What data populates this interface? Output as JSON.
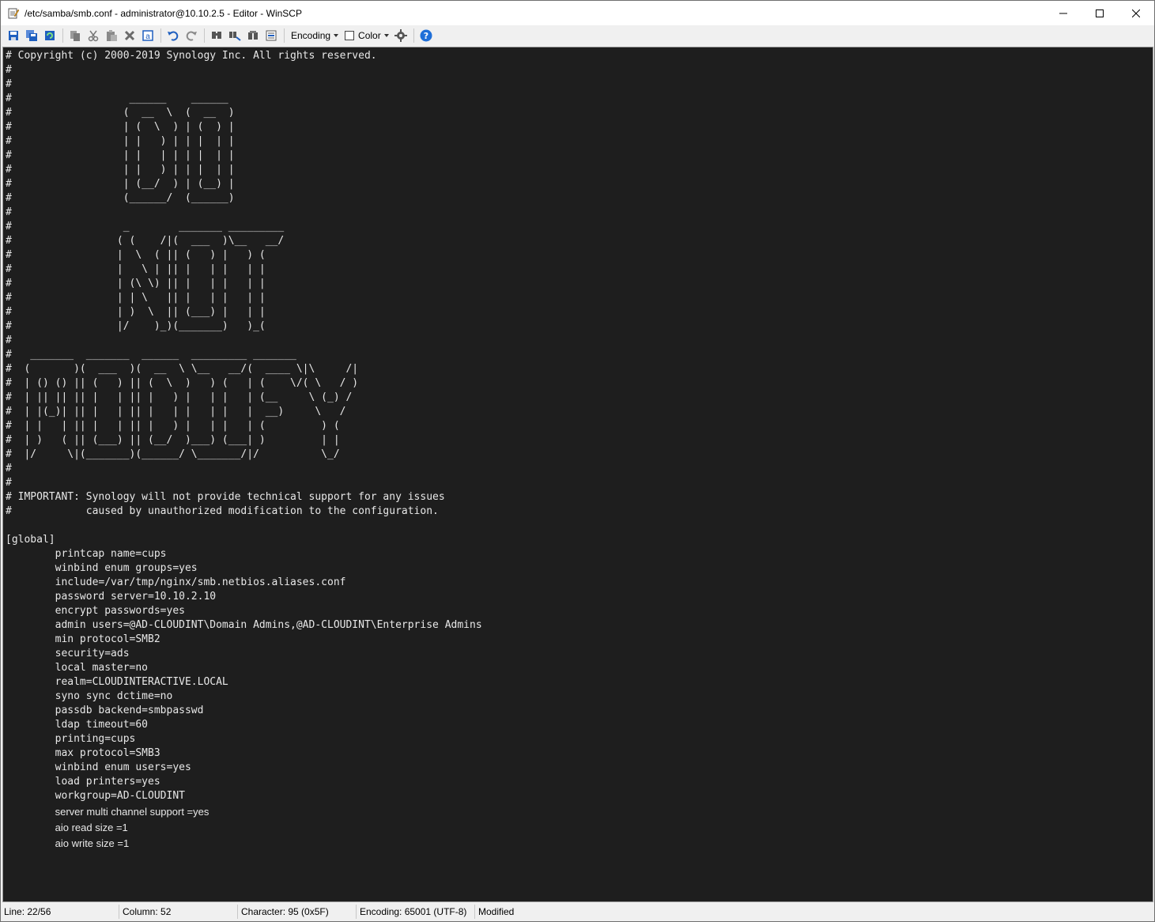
{
  "window": {
    "title": "/etc/samba/smb.conf - administrator@10.10.2.5 - Editor - WinSCP",
    "minimize_glyph": "—",
    "maximize_glyph": "☐",
    "close_glyph": "✕"
  },
  "toolbar": {
    "encoding_label": "Encoding",
    "color_label": "Color",
    "icons": [
      "save-icon",
      "save-all-icon",
      "reload-icon",
      "copy-icon",
      "cut-icon",
      "paste-icon",
      "delete-icon",
      "select-all-icon",
      "undo-icon",
      "redo-icon",
      "find-icon",
      "replace-icon",
      "find-next-icon",
      "goto-line-icon",
      "settings-icon",
      "help-icon"
    ]
  },
  "editor": {
    "lines": [
      "# Copyright (c) 2000-2019 Synology Inc. All rights reserved.",
      "#",
      "#",
      "#                   ______    ______",
      "#                  (  __  \\  (  __  )",
      "#                  | (  \\  ) | (  ) |",
      "#                  | |   ) | | |  | |",
      "#                  | |   | | | |  | |",
      "#                  | |   ) | | |  | |",
      "#                  | (__/  ) | (__) |",
      "#                  (______/  (______)",
      "#",
      "#                  _        _______ _________",
      "#                 ( (    /|(  ___  )\\__   __/",
      "#                 |  \\  ( || (   ) |   ) (",
      "#                 |   \\ | || |   | |   | |",
      "#                 | (\\ \\) || |   | |   | |",
      "#                 | | \\   || |   | |   | |",
      "#                 | )  \\  || (___) |   | |",
      "#                 |/    )_)(_______)   )_(",
      "#",
      "#   _______  _______  ______  _________ _______          ",
      "#  (       )(  ___  )(  __  \\ \\__   __/(  ____ \\|\\     /|",
      "#  | () () || (   ) || (  \\  )   ) (   | (    \\/( \\   / )",
      "#  | || || || |   | || |   ) |   | |   | (__     \\ (_) /",
      "#  | |(_)| || |   | || |   | |   | |   |  __)     \\   /",
      "#  | |   | || |   | || |   ) |   | |   | (         ) (",
      "#  | )   ( || (___) || (__/  )___) (___| )         | |",
      "#  |/     \\|(_______)(______/ \\_______/|/          \\_/",
      "#",
      "#",
      "# IMPORTANT: Synology will not provide technical support for any issues",
      "#            caused by unauthorized modification to the configuration.",
      "",
      "[global]",
      "        printcap name=cups",
      "        winbind enum groups=yes",
      "        include=/var/tmp/nginx/smb.netbios.aliases.conf",
      "        password server=10.10.2.10",
      "        encrypt passwords=yes",
      "        admin users=@AD-CLOUDINT\\Domain Admins,@AD-CLOUDINT\\Enterprise Admins",
      "        min protocol=SMB2",
      "        security=ads",
      "        local master=no",
      "        realm=CLOUDINTERACTIVE.LOCAL",
      "        syno sync dctime=no",
      "        passdb backend=smbpasswd",
      "        ldap timeout=60",
      "        printing=cups",
      "        max protocol=SMB3",
      "        winbind enum users=yes",
      "        load printers=yes",
      "        workgroup=AD-CLOUDINT"
    ],
    "extra_lines": [
      "server multi channel support =yes",
      "aio read size =1",
      "aio write size =1"
    ]
  },
  "statusbar": {
    "line": "Line: 22/56",
    "column": "Column: 52",
    "character": "Character: 95 (0x5F)",
    "encoding": "Encoding: 65001 (UTF-8)",
    "state": "Modified"
  },
  "colors": {
    "editor_bg": "#1e1e1e",
    "editor_fg": "#e8e8e8",
    "icon_blue": "#1f5fbf"
  }
}
